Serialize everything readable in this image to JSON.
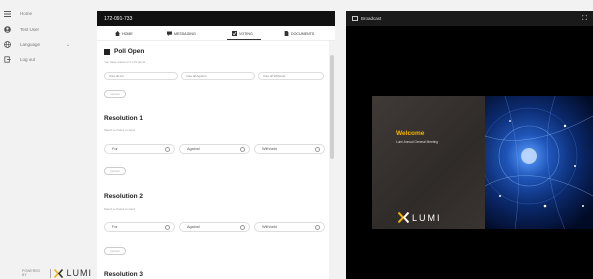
{
  "sidebar": {
    "items": [
      {
        "label": "Home",
        "icon": "hamburger-icon"
      },
      {
        "label": "Test User",
        "icon": "user-icon"
      },
      {
        "label": "Language",
        "icon": "globe-icon"
      },
      {
        "label": "Log out",
        "icon": "logout-icon"
      }
    ],
    "powered_by": "POWERED BY",
    "brand": "LUMI"
  },
  "voting": {
    "header_id": "172-091-733",
    "tabs": [
      {
        "label": "HOME",
        "icon": "home-icon"
      },
      {
        "label": "MESSAGING",
        "icon": "messaging-icon"
      },
      {
        "label": "VOTING",
        "icon": "voting-icon"
      },
      {
        "label": "DOCUMENTS",
        "icon": "documents-icon"
      }
    ],
    "active_tab": "VOTING",
    "poll_title": "Poll Open",
    "votes_note": "You have voted on 0 of 5 items",
    "bulk_buttons": [
      "Vote all For",
      "Vote all Against",
      "Vote all Withheld"
    ],
    "cancel_label": "Cancel",
    "resolutions": [
      {
        "title": "Resolution 1",
        "note": "Select a choice to send",
        "options": [
          "For",
          "Against",
          "Withheld"
        ]
      },
      {
        "title": "Resolution 2",
        "note": "Select a choice to send",
        "options": [
          "For",
          "Against",
          "Withheld"
        ]
      },
      {
        "title": "Resolution 3"
      }
    ]
  },
  "broadcast": {
    "title": "Broadcast",
    "welcome": "Welcome",
    "subtitle": "Lumi Annual General Meeting",
    "brand": "LUMI"
  },
  "colors": {
    "accent": "#f4b400",
    "header_bg": "#111111"
  }
}
